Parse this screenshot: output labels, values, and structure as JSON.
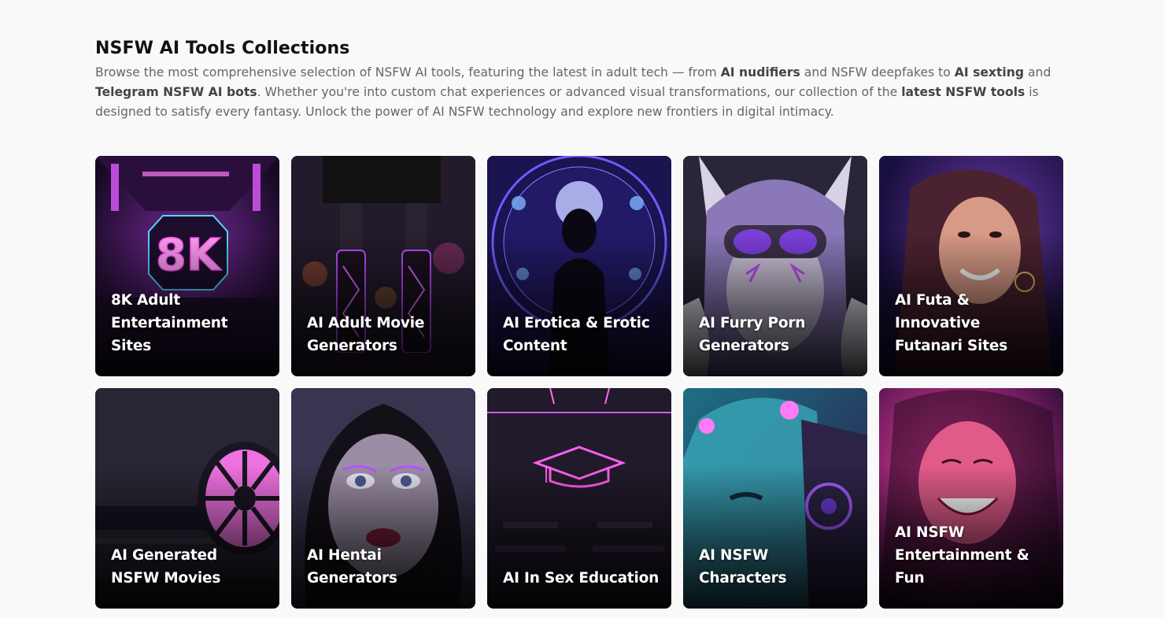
{
  "header": {
    "title": "NSFW AI Tools Collections",
    "intro": {
      "t1": "Browse the most comprehensive selection of NSFW AI tools, featuring the latest in adult tech — from ",
      "b1": "AI nudifiers",
      "t2": " and NSFW deepfakes to ",
      "b2": "AI sexting",
      "t3": " and ",
      "b3": "Telegram NSFW AI bots",
      "t4": ". Whether you're into custom chat experiences or advanced visual transformations, our collection of the ",
      "b4": "latest NSFW tools",
      "t5": " is designed to satisfy every fantasy. Unlock the power of AI NSFW technology and explore new frontiers in digital intimacy."
    }
  },
  "cards": [
    {
      "label": "8K Adult Entertainment Sites",
      "image_icon": "neon-8k-corridor-image"
    },
    {
      "label": "AI Adult Movie Generators",
      "image_icon": "neon-boots-city-image"
    },
    {
      "label": "AI Erotica & Erotic Content",
      "image_icon": "zodiac-silhouette-image"
    },
    {
      "label": "AI Furry Porn Generators",
      "image_icon": "furry-goggles-image"
    },
    {
      "label": "AI Futa & Innovative Futanari Sites",
      "image_icon": "smiling-woman-image"
    },
    {
      "label": "AI Generated NSFW Movies",
      "image_icon": "film-reel-image"
    },
    {
      "label": "AI Hentai Generators",
      "image_icon": "anime-portrait-image"
    },
    {
      "label": "AI In Sex Education",
      "image_icon": "neon-graduation-cap-image"
    },
    {
      "label": "AI NSFW Characters",
      "image_icon": "cyborg-face-image"
    },
    {
      "label": "AI NSFW Entertainment & Fun",
      "image_icon": "laughing-woman-image"
    }
  ],
  "colors": {
    "background": "#f9f9f9",
    "title": "#111111",
    "body_text": "#666666",
    "neon_accent": "#c04dff"
  }
}
